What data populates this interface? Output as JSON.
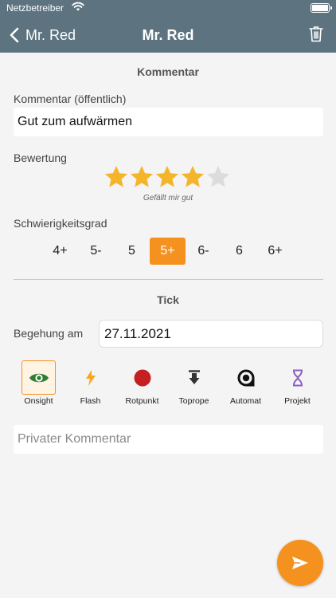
{
  "status_bar": {
    "carrier": "Netzbetreiber"
  },
  "nav": {
    "back_label": "Mr. Red",
    "title": "Mr. Red"
  },
  "comment_section": {
    "title": "Kommentar",
    "public_label": "Kommentar (öffentlich)",
    "public_value": "Gut zum aufwärmen",
    "rating_label": "Bewertung",
    "rating": 4,
    "rating_max": 5,
    "rating_caption": "Gefällt mir gut",
    "difficulty_label": "Schwierigkeitsgrad",
    "grades": [
      "4+",
      "5-",
      "5",
      "5+",
      "6-",
      "6",
      "6+"
    ],
    "selected_grade": "5+"
  },
  "tick_section": {
    "title": "Tick",
    "date_label": "Begehung am",
    "date_value": "27.11.2021",
    "types": [
      {
        "label": "Onsight",
        "icon": "eye-icon",
        "selected": true
      },
      {
        "label": "Flash",
        "icon": "flash-icon",
        "selected": false
      },
      {
        "label": "Rotpunkt",
        "icon": "red-dot-icon",
        "selected": false
      },
      {
        "label": "Toprope",
        "icon": "toprope-icon",
        "selected": false
      },
      {
        "label": "Automat",
        "icon": "automat-icon",
        "selected": false
      },
      {
        "label": "Projekt",
        "icon": "hourglass-icon",
        "selected": false
      }
    ],
    "private_placeholder": "Privater Kommentar"
  },
  "colors": {
    "header": "#5d7480",
    "accent": "#f5911f",
    "star": "#f5b52a",
    "star_empty": "#dcdcdc",
    "rotpunkt": "#c42021",
    "projekt": "#8a5fc0"
  }
}
